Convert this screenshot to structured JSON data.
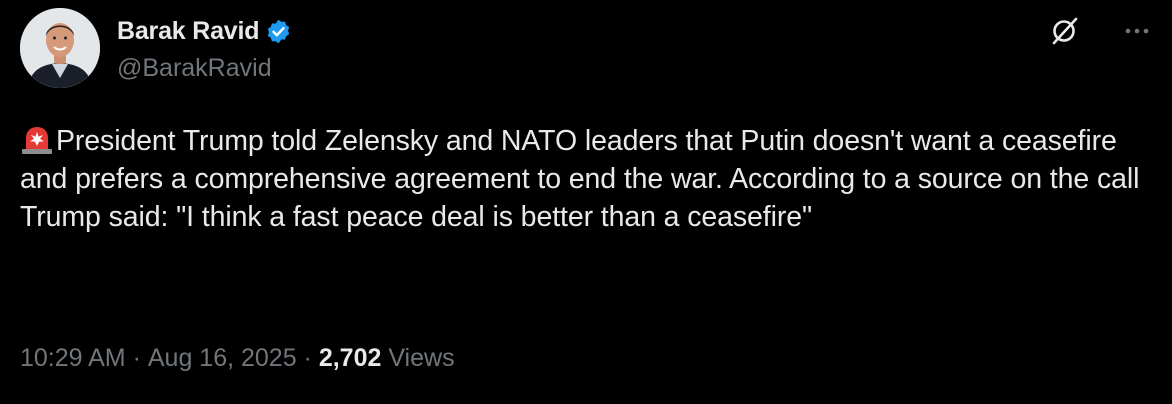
{
  "author": {
    "display_name": "Barak Ravid",
    "handle": "@BarakRavid",
    "verified": true,
    "avatar": "profile-photo"
  },
  "icons": {
    "verified": "verified-badge-icon",
    "grok": "grok-icon",
    "more": "more-options-icon",
    "emoji": "police-siren-emoji"
  },
  "tweet": {
    "text": "President Trump told Zelensky and NATO leaders that Putin doesn't want a ceasefire and prefers a comprehensive agreement to end the war. According to a source on the call Trump said: \"I think a fast peace deal is better than a ceasefire\""
  },
  "meta": {
    "time": "10:29 AM",
    "separator": " · ",
    "date": "Aug 16, 2025",
    "views_count": "2,702",
    "views_label": " Views"
  },
  "colors": {
    "background": "#000000",
    "text": "#e7e9ea",
    "secondary": "#71767b",
    "verified": "#1d9bf0"
  }
}
